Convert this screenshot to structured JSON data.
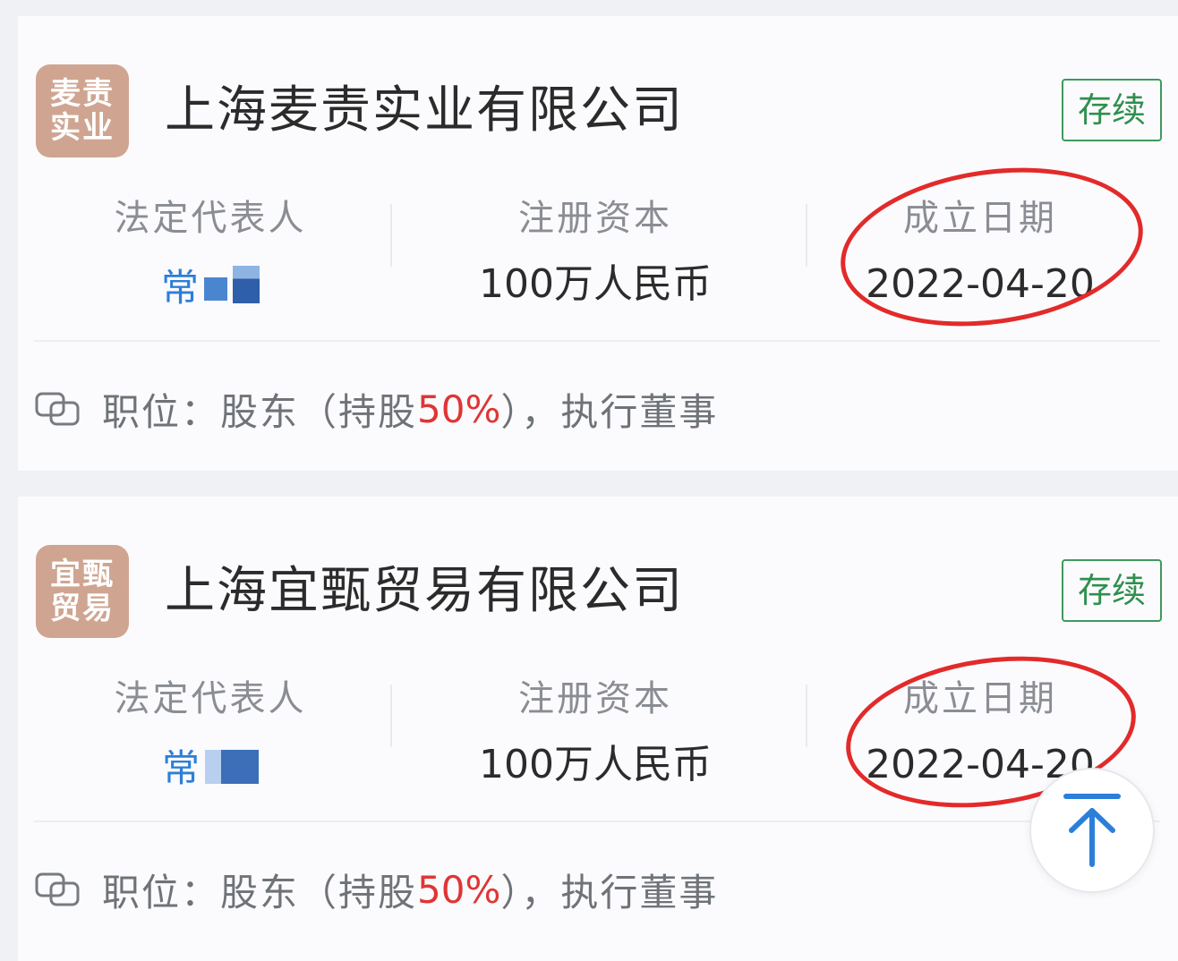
{
  "companies": [
    {
      "logo_text": "麦责实业",
      "name": "上海麦责实业有限公司",
      "status": "存续",
      "legal_rep_label": "法定代表人",
      "legal_rep_value": "常",
      "capital_label": "注册资本",
      "capital_value": "100万人民币",
      "date_label": "成立日期",
      "date_value": "2022-04-20",
      "position_label": "职位：",
      "position_prefix": "股东（持股",
      "position_percent": "50%",
      "position_suffix": "），执行董事"
    },
    {
      "logo_text": "宜甄贸易",
      "name": "上海宜甄贸易有限公司",
      "status": "存续",
      "legal_rep_label": "法定代表人",
      "legal_rep_value": "常",
      "capital_label": "注册资本",
      "capital_value": "100万人民币",
      "date_label": "成立日期",
      "date_value": "2022-04-20",
      "position_label": "职位：",
      "position_prefix": "股东（持股",
      "position_percent": "50%",
      "position_suffix": "），执行董事"
    }
  ],
  "colors": {
    "logo_bg": "#cfa591",
    "status_green": "#2f8f4e",
    "highlight_red": "#e32a2a",
    "percent_red": "#e03535",
    "link_blue": "#2c7fd8"
  },
  "icons": {
    "position": "link-icon",
    "back_to_top": "arrow-up-icon"
  }
}
